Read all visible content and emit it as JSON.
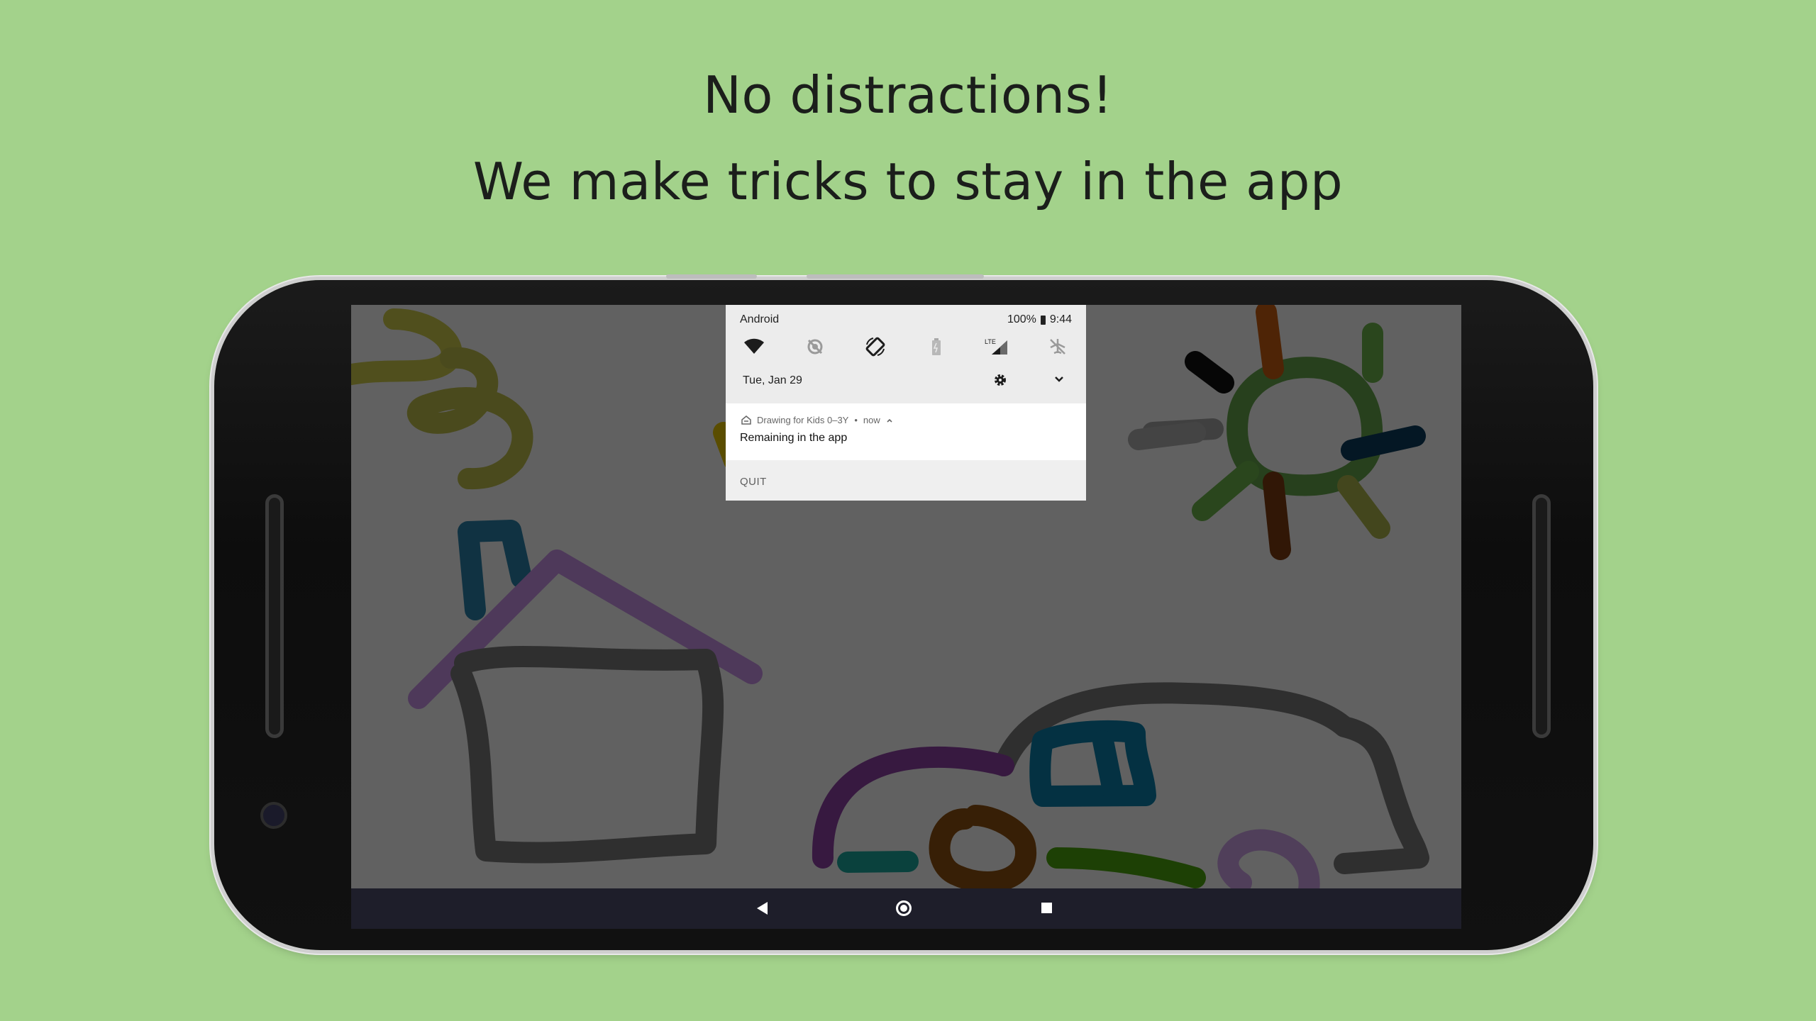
{
  "headline": {
    "line1": "No distractions!",
    "line2": "We make tricks to stay in the app"
  },
  "colors": {
    "background": "#a3d28b",
    "phone_body": "#111111",
    "navbar": "#1e1e2a"
  },
  "status": {
    "carrier": "Android",
    "battery": "100%",
    "time": "9:44"
  },
  "quick_settings": {
    "tiles": [
      "wifi-icon",
      "data-saver-icon",
      "auto-rotate-icon",
      "battery-saver-icon",
      "lte-signal-icon",
      "airplane-mode-icon"
    ],
    "date": "Tue, Jan 29"
  },
  "notification": {
    "app_name": "Drawing for Kids 0–3Y",
    "time": "now",
    "title": "Remaining in the app",
    "action": "QUIT"
  },
  "navbar": {
    "buttons": [
      "back-icon",
      "home-icon",
      "recents-icon"
    ]
  }
}
